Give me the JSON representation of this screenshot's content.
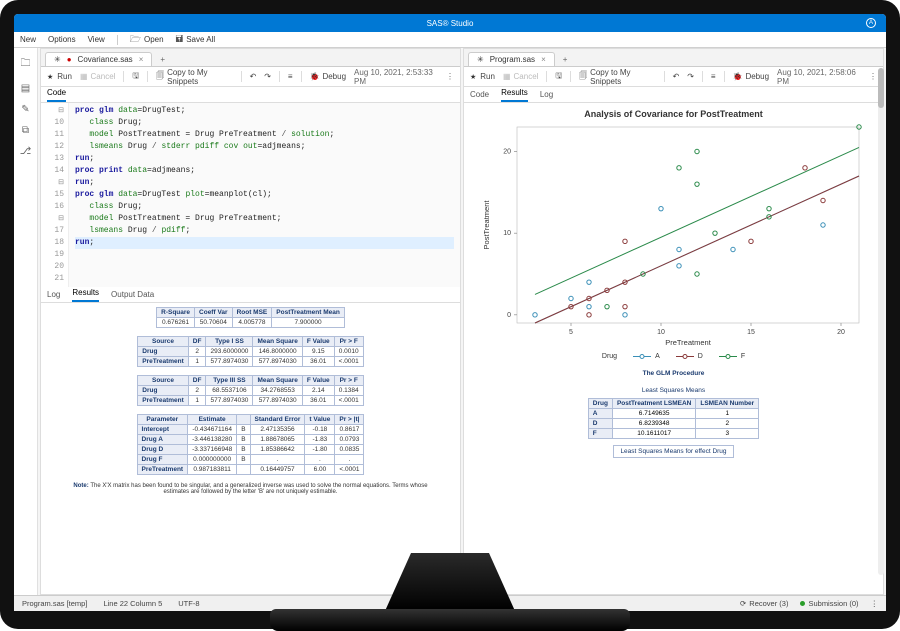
{
  "colors": {
    "brand": "#0078d4",
    "seriesA": "#3a8fb7",
    "seriesD": "#8a3a3a",
    "seriesF": "#2a8a4a"
  },
  "titlebar": {
    "app_title": "SAS® Studio"
  },
  "menubar": {
    "new": "New",
    "options": "Options",
    "view": "View",
    "open": "Open",
    "save_all": "Save All"
  },
  "left_pane": {
    "tab": {
      "dirty": "●",
      "name": "Covariance.sas",
      "close": "×",
      "plus": "+"
    },
    "toolbar": {
      "run": "Run",
      "cancel": "Cancel",
      "copy": "Copy to My Snippets",
      "debug": "Debug",
      "date": "Aug 10, 2021, 2:53:33 PM"
    },
    "subtabs": {
      "code": "Code"
    },
    "code": {
      "first_line_no": 10,
      "lines": [
        {
          "text": "proc glm data=DrugTest;",
          "fold": true,
          "indent": 0,
          "tokens": [
            [
              "kw",
              "proc glm"
            ],
            [
              "txt",
              " "
            ],
            [
              "opt",
              "data"
            ],
            [
              "txt",
              "=DrugTest;"
            ]
          ]
        },
        {
          "text": "class Drug;",
          "indent": 1,
          "tokens": [
            [
              "opt",
              "class"
            ],
            [
              "txt",
              " Drug;"
            ]
          ]
        },
        {
          "text": "model PostTreatment = Drug PreTreatment / solution;",
          "indent": 1,
          "tokens": [
            [
              "opt",
              "model"
            ],
            [
              "txt",
              " PostTreatment = Drug PreTreatment "
            ],
            [
              "slash",
              "/"
            ],
            [
              "txt",
              " "
            ],
            [
              "opt",
              "solution"
            ],
            [
              "txt",
              ";"
            ]
          ]
        },
        {
          "text": "lsmeans Drug / stderr pdiff cov out=adjmeans;",
          "indent": 1,
          "tokens": [
            [
              "opt",
              "lsmeans"
            ],
            [
              "txt",
              " Drug "
            ],
            [
              "slash",
              "/"
            ],
            [
              "txt",
              " "
            ],
            [
              "opt",
              "stderr pdiff cov out"
            ],
            [
              "txt",
              "=adjmeans;"
            ]
          ]
        },
        {
          "text": "run;",
          "indent": 0,
          "tokens": [
            [
              "kw",
              "run"
            ],
            [
              "txt",
              ";"
            ]
          ]
        },
        {
          "text": "proc print data=adjmeans;",
          "fold": true,
          "indent": 0,
          "tokens": [
            [
              "kw",
              "proc print"
            ],
            [
              "txt",
              " "
            ],
            [
              "opt",
              "data"
            ],
            [
              "txt",
              "=adjmeans;"
            ]
          ]
        },
        {
          "text": "run;",
          "indent": 0,
          "tokens": [
            [
              "kw",
              "run"
            ],
            [
              "txt",
              ";"
            ]
          ]
        },
        {
          "text": "proc glm data=DrugTest plot=meanplot(cl);",
          "fold": true,
          "indent": 0,
          "tokens": [
            [
              "kw",
              "proc glm"
            ],
            [
              "txt",
              " "
            ],
            [
              "opt",
              "data"
            ],
            [
              "txt",
              "=DrugTest "
            ],
            [
              "opt",
              "plot"
            ],
            [
              "txt",
              "=meanplot(cl);"
            ]
          ]
        },
        {
          "text": "class Drug;",
          "indent": 1,
          "tokens": [
            [
              "opt",
              "class"
            ],
            [
              "txt",
              " Drug;"
            ]
          ]
        },
        {
          "text": "model PostTreatment = Drug PreTreatment;",
          "indent": 1,
          "tokens": [
            [
              "opt",
              "model"
            ],
            [
              "txt",
              " PostTreatment = Drug PreTreatment;"
            ]
          ]
        },
        {
          "text": "lsmeans Drug / pdiff;",
          "indent": 1,
          "tokens": [
            [
              "opt",
              "lsmeans"
            ],
            [
              "txt",
              " Drug "
            ],
            [
              "slash",
              "/"
            ],
            [
              "txt",
              " "
            ],
            [
              "opt",
              "pdiff"
            ],
            [
              "txt",
              ";"
            ]
          ]
        },
        {
          "text": "run;",
          "indent": 0,
          "hl": true,
          "tokens": [
            [
              "kw",
              "run"
            ],
            [
              "txt",
              ";"
            ]
          ]
        }
      ]
    },
    "results_tabs": {
      "log": "Log",
      "results": "Results",
      "output_data": "Output Data"
    },
    "summary_table": {
      "headers": [
        "R-Square",
        "Coeff Var",
        "Root MSE",
        "PostTreatment Mean"
      ],
      "row": [
        "0.676261",
        "50.70604",
        "4.005778",
        "7.900000"
      ]
    },
    "anova1": {
      "headers": [
        "Source",
        "DF",
        "Type I SS",
        "Mean Square",
        "F Value",
        "Pr > F"
      ],
      "rows": [
        [
          "Drug",
          "2",
          "293.6000000",
          "146.8000000",
          "9.15",
          "0.0010"
        ],
        [
          "PreTreatment",
          "1",
          "577.8974030",
          "577.8974030",
          "36.01",
          "<.0001"
        ]
      ]
    },
    "anova3": {
      "headers": [
        "Source",
        "DF",
        "Type III SS",
        "Mean Square",
        "F Value",
        "Pr > F"
      ],
      "rows": [
        [
          "Drug",
          "2",
          "68.5537106",
          "34.2768553",
          "2.14",
          "0.1384"
        ],
        [
          "PreTreatment",
          "1",
          "577.8974030",
          "577.8974030",
          "36.01",
          "<.0001"
        ]
      ]
    },
    "params": {
      "headers": [
        "Parameter",
        "Estimate",
        "",
        "Standard Error",
        "t Value",
        "Pr > |t|"
      ],
      "rows": [
        [
          "Intercept",
          "-0.434671164",
          "B",
          "2.47135356",
          "-0.18",
          "0.8617"
        ],
        [
          "Drug A",
          "-3.446138280",
          "B",
          "1.88678065",
          "-1.83",
          "0.0793"
        ],
        [
          "Drug D",
          "-3.337166948",
          "B",
          "1.85386642",
          "-1.80",
          "0.0835"
        ],
        [
          "Drug F",
          "0.000000000",
          "B",
          ".",
          ".",
          "."
        ],
        [
          "PreTreatment",
          "0.987183811",
          "",
          "0.16449757",
          "6.00",
          "<.0001"
        ]
      ]
    },
    "note": {
      "label": "Note:",
      "text": "The X'X matrix has been found to be singular, and a generalized inverse was used to solve the normal equations. Terms whose estimates are followed by the letter 'B' are not uniquely estimable."
    }
  },
  "right_pane": {
    "tab": {
      "name": "Program.sas",
      "close": "×",
      "plus": "+"
    },
    "toolbar": {
      "run": "Run",
      "cancel": "Cancel",
      "copy": "Copy to My Snippets",
      "debug": "Debug",
      "date": "Aug 10, 2021, 2:58:06 PM"
    },
    "subtabs": {
      "code": "Code",
      "results": "Results",
      "log": "Log"
    },
    "chart_title": "Analysis of Covariance for PostTreatment",
    "legend_label": "Drug",
    "proc_title1": "The GLM Procedure",
    "proc_title2": "Least Squares Means",
    "lsmean_table": {
      "headers": [
        "Drug",
        "PostTreatment LSMEAN",
        "LSMEAN Number"
      ],
      "rows": [
        [
          "A",
          "6.7149635",
          "1"
        ],
        [
          "D",
          "6.8239348",
          "2"
        ],
        [
          "F",
          "10.1611017",
          "3"
        ]
      ]
    },
    "lsm_button": "Least Squares Means for effect Drug"
  },
  "statusbar": {
    "file": "Program.sas [temp]",
    "pos": "Line 22 Column 5",
    "enc": "UTF-8",
    "recover": "Recover (3)",
    "submission": "Submission (0)"
  },
  "chart_data": {
    "type": "scatter",
    "title": "Analysis of Covariance for PostTreatment",
    "xlabel": "PreTreatment",
    "ylabel": "PostTreatment",
    "xlim": [
      2,
      21
    ],
    "ylim": [
      -1,
      23
    ],
    "xticks": [
      5,
      10,
      15,
      20
    ],
    "yticks": [
      0,
      10,
      20
    ],
    "legend_title": "Drug",
    "series": [
      {
        "name": "A",
        "color": "#3a8fb7",
        "fit": {
          "x1": 3,
          "y1": -1,
          "x2": 21,
          "y2": 17
        },
        "points": [
          [
            11,
            6
          ],
          [
            8,
            0
          ],
          [
            5,
            2
          ],
          [
            14,
            8
          ],
          [
            19,
            11
          ],
          [
            6,
            4
          ],
          [
            10,
            13
          ],
          [
            6,
            1
          ],
          [
            11,
            8
          ],
          [
            3,
            0
          ]
        ]
      },
      {
        "name": "D",
        "color": "#8a3a3a",
        "fit": {
          "x1": 3,
          "y1": -1,
          "x2": 21,
          "y2": 17
        },
        "points": [
          [
            6,
            0
          ],
          [
            6,
            2
          ],
          [
            7,
            3
          ],
          [
            8,
            1
          ],
          [
            18,
            18
          ],
          [
            8,
            4
          ],
          [
            19,
            14
          ],
          [
            8,
            9
          ],
          [
            5,
            1
          ],
          [
            15,
            9
          ]
        ]
      },
      {
        "name": "F",
        "color": "#2a8a4a",
        "fit": {
          "x1": 3,
          "y1": 2.5,
          "x2": 21,
          "y2": 20.5
        },
        "points": [
          [
            16,
            13
          ],
          [
            13,
            10
          ],
          [
            11,
            18
          ],
          [
            9,
            5
          ],
          [
            21,
            23
          ],
          [
            16,
            12
          ],
          [
            12,
            5
          ],
          [
            12,
            16
          ],
          [
            7,
            1
          ],
          [
            12,
            20
          ]
        ]
      }
    ]
  }
}
